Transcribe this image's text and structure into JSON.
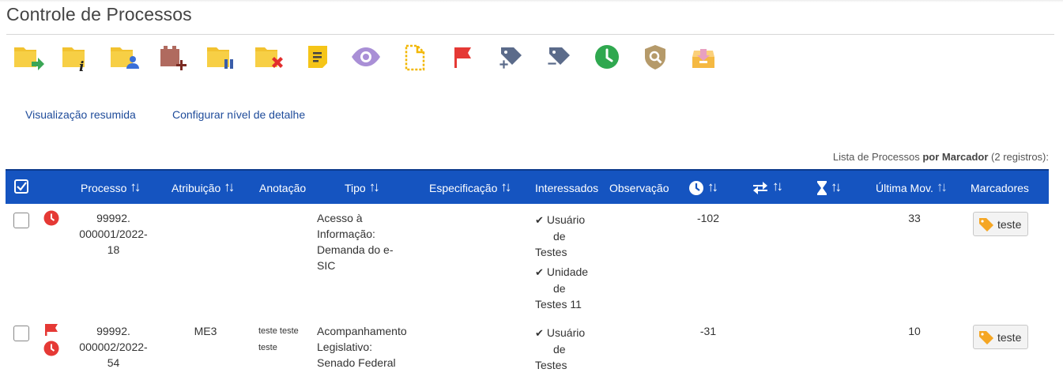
{
  "page": {
    "title": "Controle de Processos"
  },
  "links": {
    "resumida": "Visualização resumida",
    "detalhe": "Configurar nível de detalhe"
  },
  "caption": {
    "prefix": "Lista de Processos ",
    "bold": "por Marcador",
    "suffix": " (2 registros):"
  },
  "columns": {
    "processo": "Processo",
    "atribuicao": "Atribuição",
    "anotacao": "Anotação",
    "tipo": "Tipo",
    "especificacao": "Especificação",
    "interessados": "Interessados",
    "observacao": "Observação",
    "ultima_mov": "Última Mov.",
    "marcadores": "Marcadores"
  },
  "rows": [
    {
      "processo": [
        "99992.",
        "000001/2022-",
        "18"
      ],
      "atribuicao": "",
      "anotacao": "",
      "tipo": [
        "Acesso à",
        "Informação:",
        "Demanda do e-",
        "SIC"
      ],
      "interessados": [
        [
          "Usuário",
          "de",
          "Testes"
        ],
        [
          "Unidade",
          "de",
          "Testes 11"
        ]
      ],
      "prazo": "-102",
      "ultima_mov": "33",
      "marcador": "teste"
    },
    {
      "processo": [
        "99992.",
        "000002/2022-",
        "54"
      ],
      "atribuicao": "ME3",
      "anotacao": [
        "teste teste",
        "teste"
      ],
      "tipo": [
        "Acompanhamento",
        "Legislativo:",
        "Senado Federal"
      ],
      "interessados": [
        [
          "Usuário",
          "de",
          "Testes"
        ]
      ],
      "prazo": "-31",
      "ultima_mov": "10",
      "marcador": "teste"
    }
  ],
  "colors": {
    "header": "#1554c0",
    "accent_red": "#e53935",
    "link": "#1e4b9a",
    "tag_yellow": "#f5a623"
  }
}
